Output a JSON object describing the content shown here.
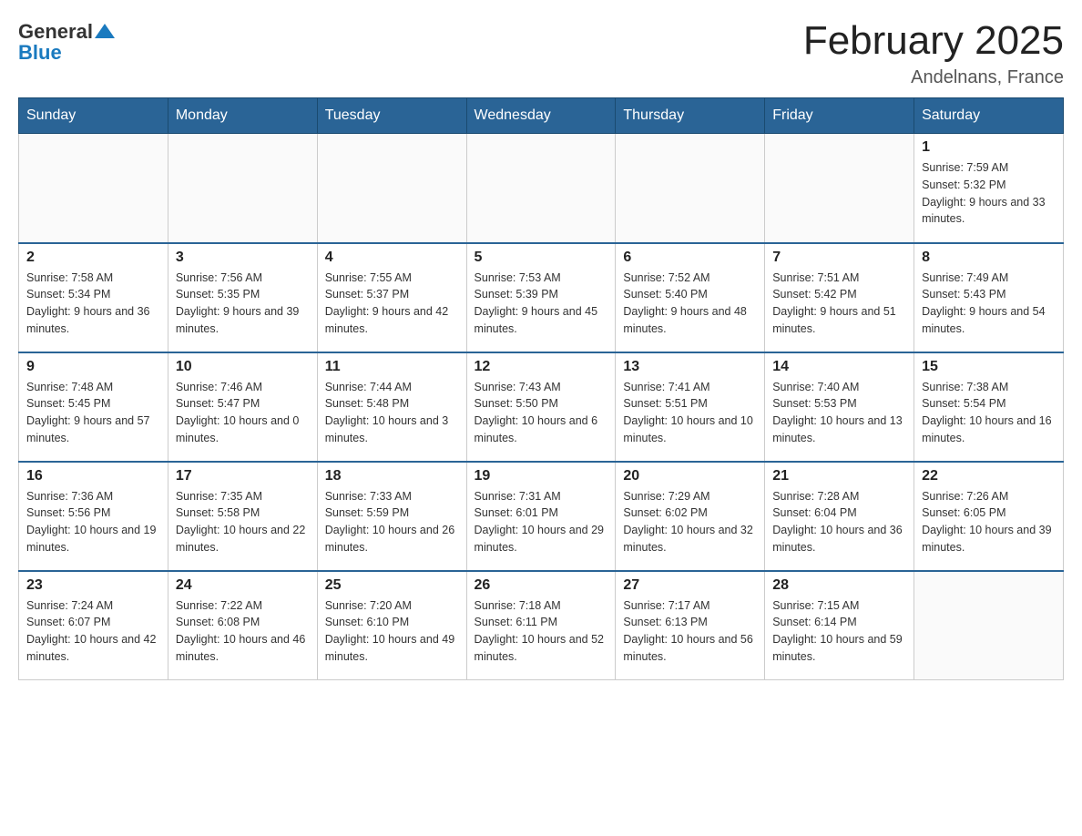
{
  "header": {
    "logo": {
      "text_general": "General",
      "text_blue": "Blue"
    },
    "title": "February 2025",
    "location": "Andelnans, France"
  },
  "days_of_week": [
    "Sunday",
    "Monday",
    "Tuesday",
    "Wednesday",
    "Thursday",
    "Friday",
    "Saturday"
  ],
  "weeks": [
    {
      "days": [
        {
          "number": "",
          "info": ""
        },
        {
          "number": "",
          "info": ""
        },
        {
          "number": "",
          "info": ""
        },
        {
          "number": "",
          "info": ""
        },
        {
          "number": "",
          "info": ""
        },
        {
          "number": "",
          "info": ""
        },
        {
          "number": "1",
          "info": "Sunrise: 7:59 AM\nSunset: 5:32 PM\nDaylight: 9 hours and 33 minutes."
        }
      ]
    },
    {
      "days": [
        {
          "number": "2",
          "info": "Sunrise: 7:58 AM\nSunset: 5:34 PM\nDaylight: 9 hours and 36 minutes."
        },
        {
          "number": "3",
          "info": "Sunrise: 7:56 AM\nSunset: 5:35 PM\nDaylight: 9 hours and 39 minutes."
        },
        {
          "number": "4",
          "info": "Sunrise: 7:55 AM\nSunset: 5:37 PM\nDaylight: 9 hours and 42 minutes."
        },
        {
          "number": "5",
          "info": "Sunrise: 7:53 AM\nSunset: 5:39 PM\nDaylight: 9 hours and 45 minutes."
        },
        {
          "number": "6",
          "info": "Sunrise: 7:52 AM\nSunset: 5:40 PM\nDaylight: 9 hours and 48 minutes."
        },
        {
          "number": "7",
          "info": "Sunrise: 7:51 AM\nSunset: 5:42 PM\nDaylight: 9 hours and 51 minutes."
        },
        {
          "number": "8",
          "info": "Sunrise: 7:49 AM\nSunset: 5:43 PM\nDaylight: 9 hours and 54 minutes."
        }
      ]
    },
    {
      "days": [
        {
          "number": "9",
          "info": "Sunrise: 7:48 AM\nSunset: 5:45 PM\nDaylight: 9 hours and 57 minutes."
        },
        {
          "number": "10",
          "info": "Sunrise: 7:46 AM\nSunset: 5:47 PM\nDaylight: 10 hours and 0 minutes."
        },
        {
          "number": "11",
          "info": "Sunrise: 7:44 AM\nSunset: 5:48 PM\nDaylight: 10 hours and 3 minutes."
        },
        {
          "number": "12",
          "info": "Sunrise: 7:43 AM\nSunset: 5:50 PM\nDaylight: 10 hours and 6 minutes."
        },
        {
          "number": "13",
          "info": "Sunrise: 7:41 AM\nSunset: 5:51 PM\nDaylight: 10 hours and 10 minutes."
        },
        {
          "number": "14",
          "info": "Sunrise: 7:40 AM\nSunset: 5:53 PM\nDaylight: 10 hours and 13 minutes."
        },
        {
          "number": "15",
          "info": "Sunrise: 7:38 AM\nSunset: 5:54 PM\nDaylight: 10 hours and 16 minutes."
        }
      ]
    },
    {
      "days": [
        {
          "number": "16",
          "info": "Sunrise: 7:36 AM\nSunset: 5:56 PM\nDaylight: 10 hours and 19 minutes."
        },
        {
          "number": "17",
          "info": "Sunrise: 7:35 AM\nSunset: 5:58 PM\nDaylight: 10 hours and 22 minutes."
        },
        {
          "number": "18",
          "info": "Sunrise: 7:33 AM\nSunset: 5:59 PM\nDaylight: 10 hours and 26 minutes."
        },
        {
          "number": "19",
          "info": "Sunrise: 7:31 AM\nSunset: 6:01 PM\nDaylight: 10 hours and 29 minutes."
        },
        {
          "number": "20",
          "info": "Sunrise: 7:29 AM\nSunset: 6:02 PM\nDaylight: 10 hours and 32 minutes."
        },
        {
          "number": "21",
          "info": "Sunrise: 7:28 AM\nSunset: 6:04 PM\nDaylight: 10 hours and 36 minutes."
        },
        {
          "number": "22",
          "info": "Sunrise: 7:26 AM\nSunset: 6:05 PM\nDaylight: 10 hours and 39 minutes."
        }
      ]
    },
    {
      "days": [
        {
          "number": "23",
          "info": "Sunrise: 7:24 AM\nSunset: 6:07 PM\nDaylight: 10 hours and 42 minutes."
        },
        {
          "number": "24",
          "info": "Sunrise: 7:22 AM\nSunset: 6:08 PM\nDaylight: 10 hours and 46 minutes."
        },
        {
          "number": "25",
          "info": "Sunrise: 7:20 AM\nSunset: 6:10 PM\nDaylight: 10 hours and 49 minutes."
        },
        {
          "number": "26",
          "info": "Sunrise: 7:18 AM\nSunset: 6:11 PM\nDaylight: 10 hours and 52 minutes."
        },
        {
          "number": "27",
          "info": "Sunrise: 7:17 AM\nSunset: 6:13 PM\nDaylight: 10 hours and 56 minutes."
        },
        {
          "number": "28",
          "info": "Sunrise: 7:15 AM\nSunset: 6:14 PM\nDaylight: 10 hours and 59 minutes."
        },
        {
          "number": "",
          "info": ""
        }
      ]
    }
  ]
}
